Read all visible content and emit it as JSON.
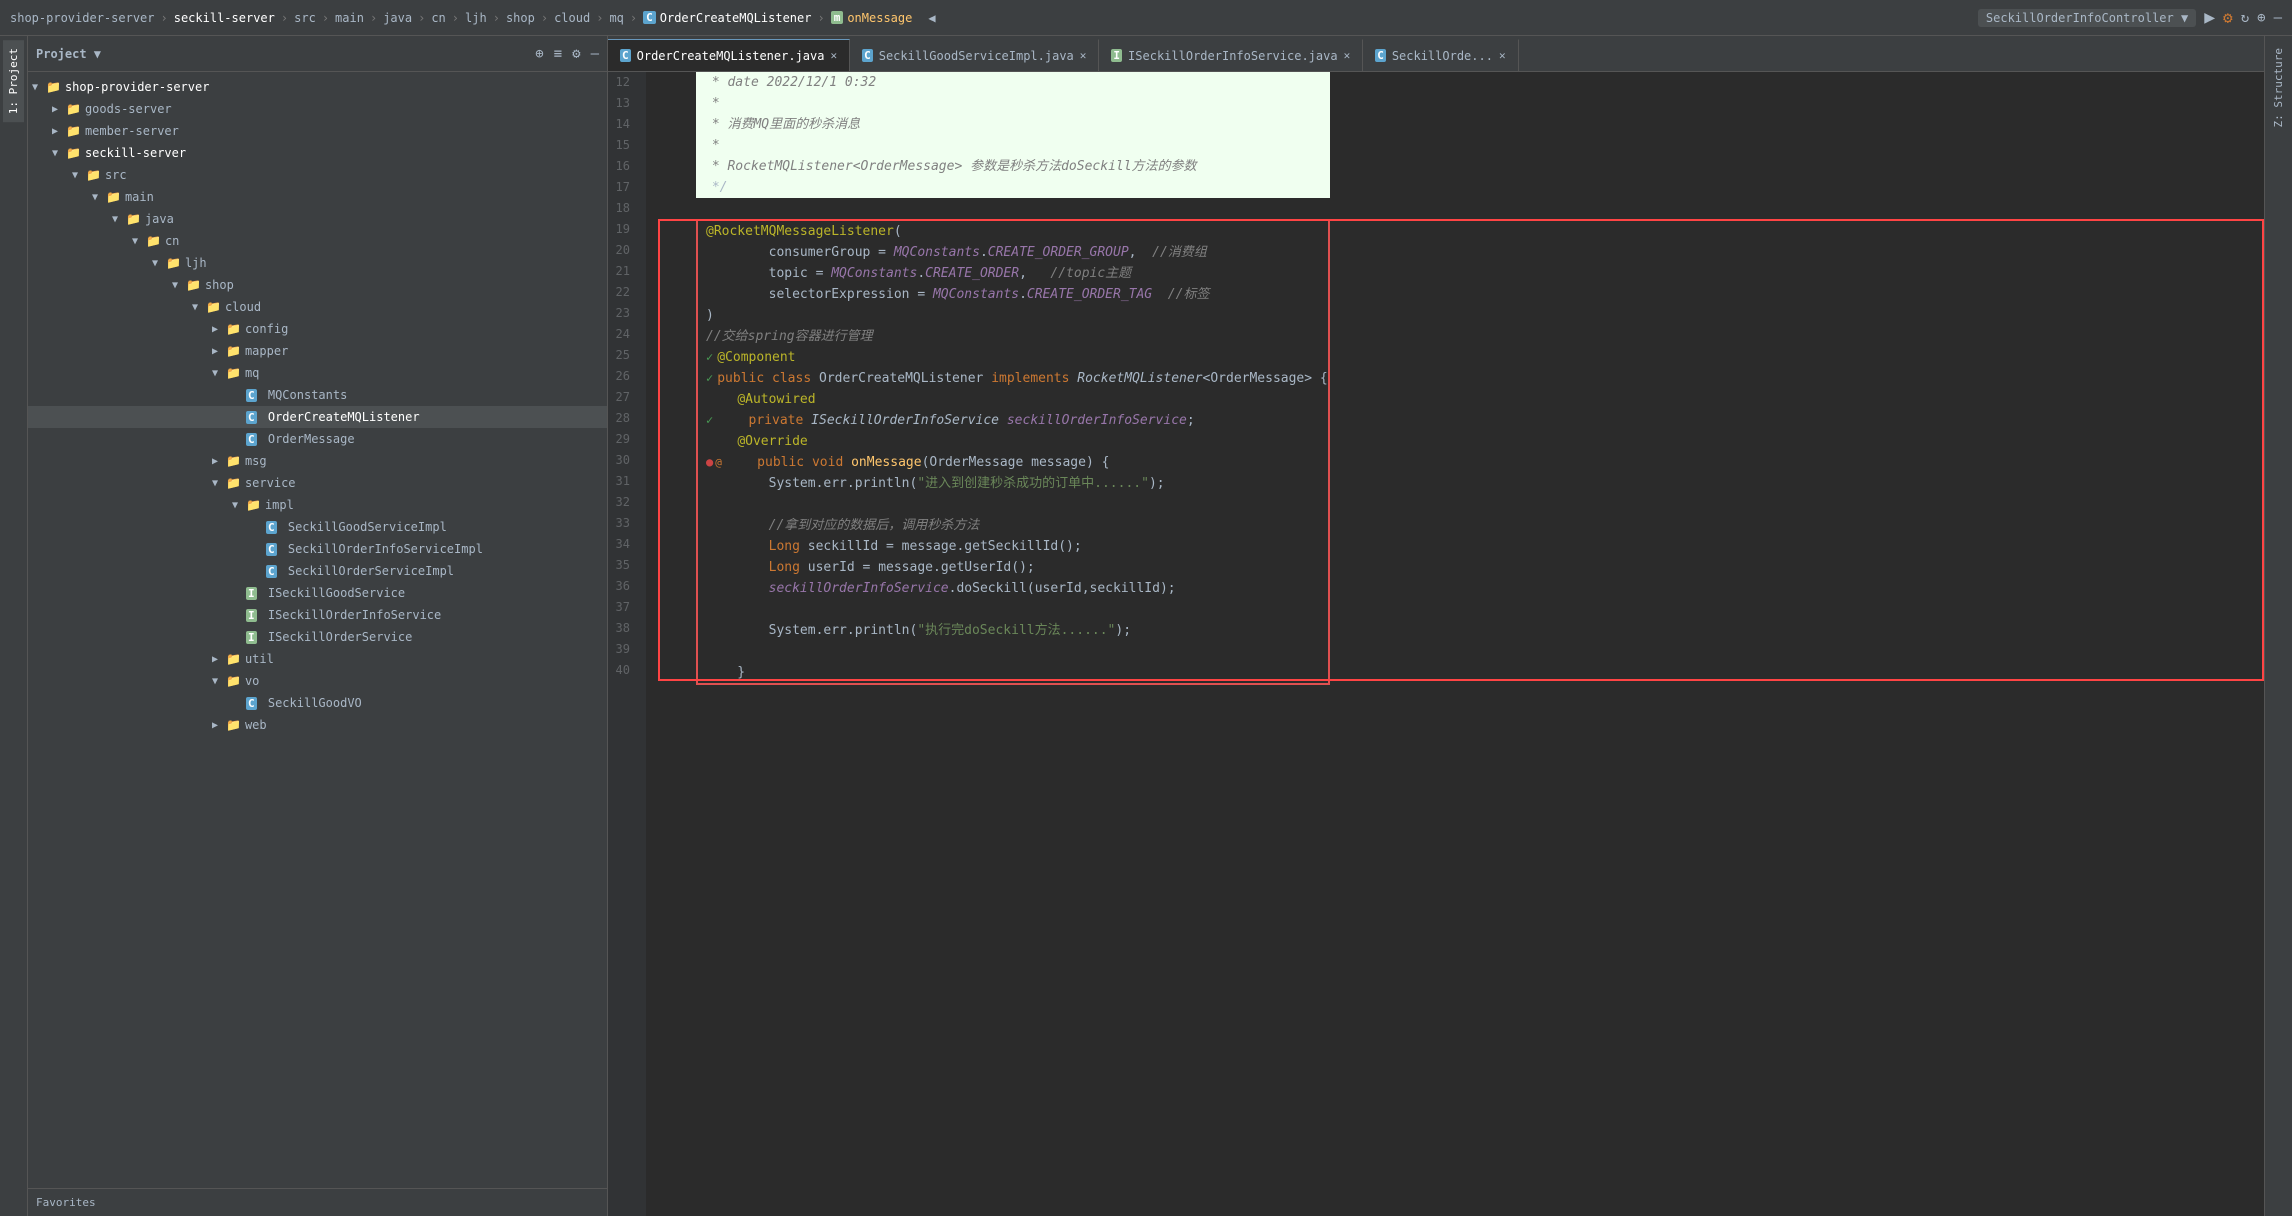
{
  "breadcrumb": {
    "items": [
      "shop-provider-server",
      "seckill-server",
      "src",
      "main",
      "java",
      "cn",
      "ljh",
      "shop",
      "cloud",
      "mq",
      "OrderCreateMQListener",
      "onMessage"
    ],
    "controller": "SeckillOrderInfoController",
    "method_icon": "◀"
  },
  "tabs": {
    "run_button_label": "▶",
    "debug_button_label": "⚙",
    "more_buttons": [
      "↻",
      "⊕",
      "—"
    ]
  },
  "sidebar": {
    "project_label": "Project",
    "controls": [
      "⊕",
      "≡",
      "⚙",
      "—"
    ]
  },
  "tree": {
    "items": [
      {
        "id": "shop-provider-server",
        "label": "shop-provider-server",
        "level": 0,
        "type": "folder",
        "expanded": true
      },
      {
        "id": "goods-server",
        "label": "goods-server",
        "level": 1,
        "type": "folder",
        "expanded": false
      },
      {
        "id": "member-server",
        "label": "member-server",
        "level": 1,
        "type": "folder",
        "expanded": false
      },
      {
        "id": "seckill-server",
        "label": "seckill-server",
        "level": 1,
        "type": "folder",
        "expanded": true
      },
      {
        "id": "src",
        "label": "src",
        "level": 2,
        "type": "folder",
        "expanded": true
      },
      {
        "id": "main",
        "label": "main",
        "level": 3,
        "type": "folder",
        "expanded": true
      },
      {
        "id": "java",
        "label": "java",
        "level": 4,
        "type": "folder",
        "expanded": true
      },
      {
        "id": "cn",
        "label": "cn",
        "level": 5,
        "type": "folder",
        "expanded": true
      },
      {
        "id": "ljh",
        "label": "ljh",
        "level": 6,
        "type": "folder",
        "expanded": true
      },
      {
        "id": "shop",
        "label": "shop",
        "level": 7,
        "type": "folder",
        "expanded": true
      },
      {
        "id": "cloud",
        "label": "cloud",
        "level": 8,
        "type": "folder",
        "expanded": true
      },
      {
        "id": "config",
        "label": "config",
        "level": 9,
        "type": "folder",
        "expanded": false
      },
      {
        "id": "mapper",
        "label": "mapper",
        "level": 9,
        "type": "folder",
        "expanded": false
      },
      {
        "id": "mq",
        "label": "mq",
        "level": 9,
        "type": "folder",
        "expanded": true
      },
      {
        "id": "MQConstants",
        "label": "MQConstants",
        "level": 10,
        "type": "class"
      },
      {
        "id": "OrderCreateMQListener",
        "label": "OrderCreateMQListener",
        "level": 10,
        "type": "class",
        "selected": true
      },
      {
        "id": "OrderMessage",
        "label": "OrderMessage",
        "level": 10,
        "type": "class"
      },
      {
        "id": "msg",
        "label": "msg",
        "level": 9,
        "type": "folder",
        "expanded": false
      },
      {
        "id": "service",
        "label": "service",
        "level": 9,
        "type": "folder",
        "expanded": true
      },
      {
        "id": "impl",
        "label": "impl",
        "level": 10,
        "type": "folder",
        "expanded": true
      },
      {
        "id": "SeckillGoodServiceImpl",
        "label": "SeckillGoodServiceImpl",
        "level": 11,
        "type": "class"
      },
      {
        "id": "SeckillOrderInfoServiceImpl",
        "label": "SeckillOrderInfoServiceImpl",
        "level": 11,
        "type": "class"
      },
      {
        "id": "SeckillOrderServiceImpl",
        "label": "SeckillOrderServiceImpl",
        "level": 11,
        "type": "class"
      },
      {
        "id": "ISeckillGoodService",
        "label": "ISeckillGoodService",
        "level": 10,
        "type": "interface"
      },
      {
        "id": "ISeckillOrderInfoService",
        "label": "ISeckillOrderInfoService",
        "level": 10,
        "type": "interface"
      },
      {
        "id": "ISeckillOrderService",
        "label": "ISeckillOrderService",
        "level": 10,
        "type": "interface"
      },
      {
        "id": "util",
        "label": "util",
        "level": 9,
        "type": "folder",
        "expanded": false
      },
      {
        "id": "vo",
        "label": "vo",
        "level": 9,
        "type": "folder",
        "expanded": true
      },
      {
        "id": "SeckillGoodVO",
        "label": "SeckillGoodVO",
        "level": 10,
        "type": "class"
      },
      {
        "id": "web",
        "label": "web",
        "level": 9,
        "type": "folder",
        "expanded": false
      }
    ]
  },
  "editor_tabs": [
    {
      "label": "OrderCreateMQListener.java",
      "type": "class",
      "active": true
    },
    {
      "label": "SeckillGoodServiceImpl.java",
      "type": "class",
      "active": false
    },
    {
      "label": "ISeckillOrderInfoService.java",
      "type": "interface",
      "active": false
    },
    {
      "label": "SeckillOrde...",
      "type": "class",
      "active": false
    }
  ],
  "code_lines": [
    {
      "num": 12,
      "gutter": "",
      "green": true,
      "text": " * date 2022/12/1 0:32"
    },
    {
      "num": 13,
      "gutter": "",
      "green": true,
      "text": " *"
    },
    {
      "num": 14,
      "gutter": "",
      "green": true,
      "text": " * 消费MQ里面的秒杀消息"
    },
    {
      "num": 15,
      "gutter": "",
      "green": true,
      "text": " *"
    },
    {
      "num": 16,
      "gutter": "",
      "green": true,
      "text": " * RocketMQListener<OrderMessage> 参数是秒杀方法doSeckill方法的参数"
    },
    {
      "num": 17,
      "gutter": "",
      "green": true,
      "text": " */"
    },
    {
      "num": 18,
      "gutter": "",
      "green": false,
      "text": ""
    },
    {
      "num": 19,
      "gutter": "",
      "green": false,
      "text": "@RocketMQMessageListener("
    },
    {
      "num": 20,
      "gutter": "",
      "green": false,
      "text": "        consumerGroup = MQConstants.CREATE_ORDER_GROUP,  //消费组"
    },
    {
      "num": 21,
      "gutter": "",
      "green": false,
      "text": "        topic = MQConstants.CREATE_ORDER,   //topic主题"
    },
    {
      "num": 22,
      "gutter": "",
      "green": false,
      "text": "        selectorExpression = MQConstants.CREATE_ORDER_TAG  //标签"
    },
    {
      "num": 23,
      "gutter": "",
      "green": false,
      "text": ")"
    },
    {
      "num": 24,
      "gutter": "",
      "green": false,
      "text": "//交给spring容器进行管理"
    },
    {
      "num": 25,
      "gutter": "✓",
      "green": false,
      "text": "@Component"
    },
    {
      "num": 26,
      "gutter": "✓",
      "green": false,
      "text": "public class OrderCreateMQListener implements RocketMQListener<OrderMessage> {"
    },
    {
      "num": 27,
      "gutter": "",
      "green": false,
      "text": "    @Autowired"
    },
    {
      "num": 28,
      "gutter": "✓",
      "green": false,
      "text": "    private ISeckillOrderInfoService seckillOrderInfoService;"
    },
    {
      "num": 29,
      "gutter": "",
      "green": false,
      "text": "    @Override"
    },
    {
      "num": 30,
      "gutter": "●@",
      "green": false,
      "text": "    public void onMessage(OrderMessage message) {"
    },
    {
      "num": 31,
      "gutter": "",
      "green": false,
      "text": "        System.err.println(\"进入到创建秒杀成功的订单中......\");"
    },
    {
      "num": 32,
      "gutter": "",
      "green": false,
      "text": ""
    },
    {
      "num": 33,
      "gutter": "",
      "green": false,
      "text": "        //拿到对应的数据后，调用秒杀方法"
    },
    {
      "num": 34,
      "gutter": "",
      "green": false,
      "text": "        Long seckillId = message.getSeckillId();"
    },
    {
      "num": 35,
      "gutter": "",
      "green": false,
      "text": "        Long userId = message.getUserId();"
    },
    {
      "num": 36,
      "gutter": "",
      "green": false,
      "text": "        seckillOrderInfoService.doSeckill(userId,seckillId);"
    },
    {
      "num": 37,
      "gutter": "",
      "green": false,
      "text": ""
    },
    {
      "num": 38,
      "gutter": "",
      "green": false,
      "text": "        System.err.println(\"执行完doSeckill方法......\");"
    },
    {
      "num": 39,
      "gutter": "",
      "green": false,
      "text": ""
    },
    {
      "num": 40,
      "gutter": "",
      "green": false,
      "text": "    }"
    }
  ],
  "right_panel": {
    "label": "Z: Structure"
  },
  "bottom_panel": {
    "label": "Favorites"
  }
}
